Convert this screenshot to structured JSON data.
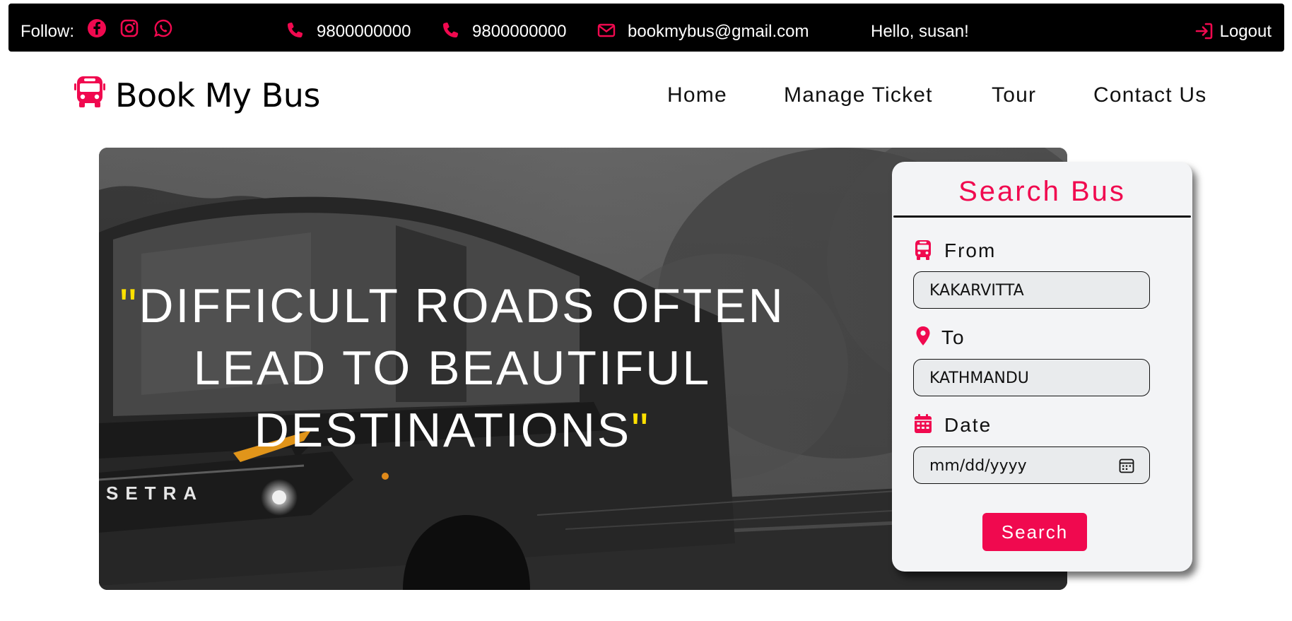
{
  "topbar": {
    "follow_label": "Follow:",
    "social": [
      "facebook-icon",
      "instagram-icon",
      "whatsapp-icon"
    ],
    "phone_1": "9800000000",
    "phone_2": "9800000000",
    "email": "bookmybus@gmail.com",
    "greeting": "Hello, susan!",
    "logout_label": "Logout"
  },
  "brand": {
    "name": "Book My Bus",
    "icon": "bus-icon"
  },
  "nav": {
    "items": [
      {
        "label": "Home"
      },
      {
        "label": "Manage Ticket"
      },
      {
        "label": "Tour"
      },
      {
        "label": "Contact Us"
      }
    ]
  },
  "hero": {
    "open_quote": "\"",
    "line_1": "DIFFICULT ROADS OFTEN",
    "line_2": "LEAD TO BEAUTIFUL",
    "line_3": "DESTINATIONS",
    "close_quote": "\"",
    "bus_brand": "SETRA"
  },
  "search_card": {
    "title": "Search Bus",
    "from": {
      "label": "From",
      "value": "KAKARVITTA",
      "icon": "bus-icon"
    },
    "to": {
      "label": "To",
      "value": "KATHMANDU",
      "icon": "map-pin-icon"
    },
    "date": {
      "label": "Date",
      "placeholder": "mm/dd/yyyy",
      "icon": "calendar-icon"
    },
    "button_label": "Search"
  },
  "colors": {
    "accent": "#f0094f",
    "topbar_bg": "#000000",
    "quote_mark": "#ffe100",
    "card_bg": "#f3f4f6"
  }
}
